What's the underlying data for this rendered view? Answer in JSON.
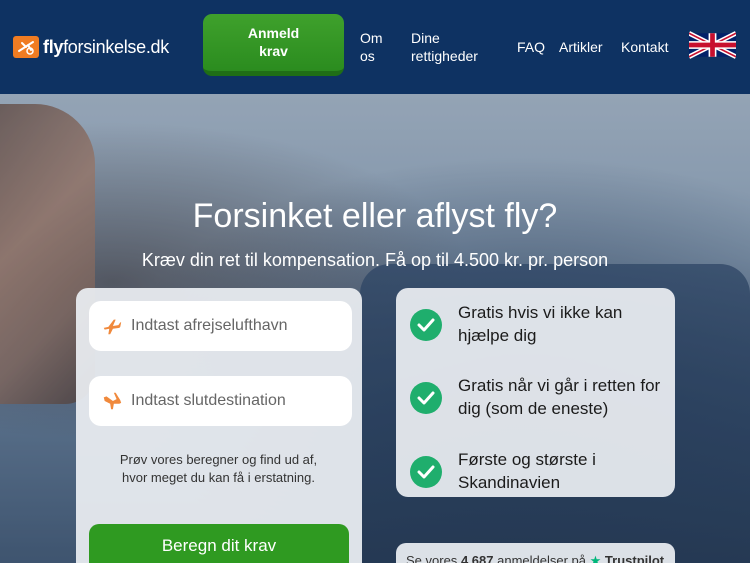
{
  "header": {
    "logo_bold": "fly",
    "logo_rest": "forsinkelse.dk",
    "cta_label": "Anmeld krav",
    "nav": {
      "om_os": "Om os",
      "rettigheder": "Dine rettigheder",
      "faq": "FAQ",
      "artikler": "Artikler",
      "kontakt": "Kontakt"
    },
    "language_icon": "uk-flag-icon"
  },
  "hero": {
    "title": "Forsinket eller aflyst fly?",
    "subtitle": "Kræv din ret til kompensation. Få op til 4.500 kr. pr. person"
  },
  "form": {
    "departure_placeholder": "Indtast afrejselufthavn",
    "destination_placeholder": "Indtast slutdestination",
    "note": "Prøv vores beregner og find ud af, hvor meget du kan få i erstatning.",
    "submit_label": "Beregn dit krav"
  },
  "benefits": [
    {
      "text": "Gratis hvis vi ikke kan hjælpe dig"
    },
    {
      "text": "Gratis når vi går i retten for dig (som de eneste)"
    },
    {
      "text": "Første og største i Skandinavien"
    }
  ],
  "reviews": {
    "prefix": "Se vores",
    "count": "4.687",
    "suffix": "anmeldelser på",
    "brand": "Trustpilot"
  },
  "colors": {
    "header_bg": "#0e3262",
    "cta_green": "#2f9a21",
    "check_green": "#1fae6d",
    "logo_orange": "#f07c22",
    "plane_orange": "#f0893c"
  }
}
